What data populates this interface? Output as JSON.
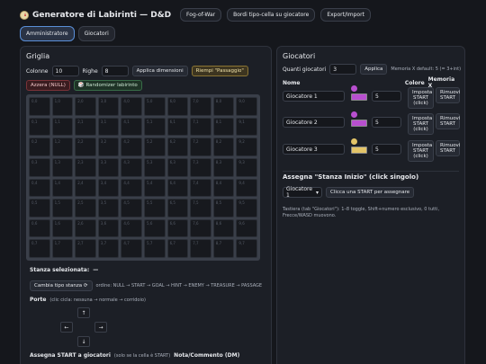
{
  "app": {
    "title": "Generatore di Labirinti — D&D",
    "header_buttons": [
      "Fog-of-War",
      "Bordi tipo-cella su giocatore",
      "Export/Import"
    ]
  },
  "tabs": [
    "Amministratore",
    "Giocatori"
  ],
  "griglia": {
    "title": "Griglia",
    "colonne_label": "Colonne",
    "colonne_value": "10",
    "righe_label": "Righe",
    "righe_value": "8",
    "apply_dims": "Applica dimensioni",
    "fill_btn": "Riempi \"Passaggio\"",
    "reset_btn": "Azzera (NULL)",
    "random_btn": "Randomizer labirinto",
    "cells": [
      [
        "0,0",
        "1,0",
        "2,0",
        "3,0",
        "4,0",
        "5,0",
        "6,0",
        "7,0",
        "8,0",
        "9,0"
      ],
      [
        "0,1",
        "1,1",
        "2,1",
        "3,1",
        "4,1",
        "5,1",
        "6,1",
        "7,1",
        "8,1",
        "9,1"
      ],
      [
        "0,2",
        "1,2",
        "2,2",
        "3,2",
        "4,2",
        "5,2",
        "6,2",
        "7,2",
        "8,2",
        "9,2"
      ],
      [
        "0,3",
        "1,3",
        "2,3",
        "3,3",
        "4,3",
        "5,3",
        "6,3",
        "7,3",
        "8,3",
        "9,3"
      ],
      [
        "0,4",
        "1,4",
        "2,4",
        "3,4",
        "4,4",
        "5,4",
        "6,4",
        "7,4",
        "8,4",
        "9,4"
      ],
      [
        "0,5",
        "1,5",
        "2,5",
        "3,5",
        "4,5",
        "5,5",
        "6,5",
        "7,5",
        "8,5",
        "9,5"
      ],
      [
        "0,6",
        "1,6",
        "2,6",
        "3,6",
        "4,6",
        "5,6",
        "6,6",
        "7,6",
        "8,6",
        "9,6"
      ],
      [
        "0,7",
        "1,7",
        "2,7",
        "3,7",
        "4,7",
        "5,7",
        "6,7",
        "7,7",
        "8,7",
        "9,7"
      ]
    ]
  },
  "stanza": {
    "selected_label": "Stanza selezionata:",
    "selected_value": "—",
    "change_btn": "Cambia tipo stanza ⟳",
    "order_text": "ordine: NULL → START → GOAL → HINT → ENEMY → TREASURE → PASSAGE",
    "porte_label": "Porte",
    "porte_hint": "(clic cicla: nessuna → normale → corridoio)",
    "arrows": {
      "up": "↑",
      "left": "←",
      "right": "→",
      "down": "↓"
    },
    "assign_label": "Assegna START a giocatori",
    "assign_hint": "(solo se la cella è START)",
    "note_label": "Nota/Commento (DM)"
  },
  "giocatori": {
    "title": "Giocatori",
    "count_label": "Quanti giocatori",
    "count_value": "3",
    "apply_btn": "Applica",
    "memory_default": "Memoria X default: 5 (= 3+int)",
    "col_nome": "Nome",
    "col_colore": "Colore",
    "col_memoria": "Memoria X",
    "players": [
      {
        "name": "Giocatore 1",
        "color": "#b84fcf",
        "memory": "5",
        "start_btn": "Imposta START (click)",
        "remove_btn": "Rimuovi START"
      },
      {
        "name": "Giocatore 2",
        "color": "#b84fcf",
        "memory": "5",
        "start_btn": "Imposta START (click)",
        "remove_btn": "Rimuovi START"
      },
      {
        "name": "Giocatore 3",
        "color": "#e3c468",
        "memory": "5",
        "start_btn": "Imposta START (click)",
        "remove_btn": "Rimuovi START"
      }
    ],
    "assign_title": "Assegna \"Stanza Inizio\" (click singolo)",
    "assign_select": "Giocatore 1",
    "assign_btn": "Clicca una START per assegnare",
    "keyboard_hint": "Tastiera (tab \"Giocatori\"): 1–8 toggle, Shift+numero esclusivo, 0 tutti, Frecce/WASD muovono."
  }
}
